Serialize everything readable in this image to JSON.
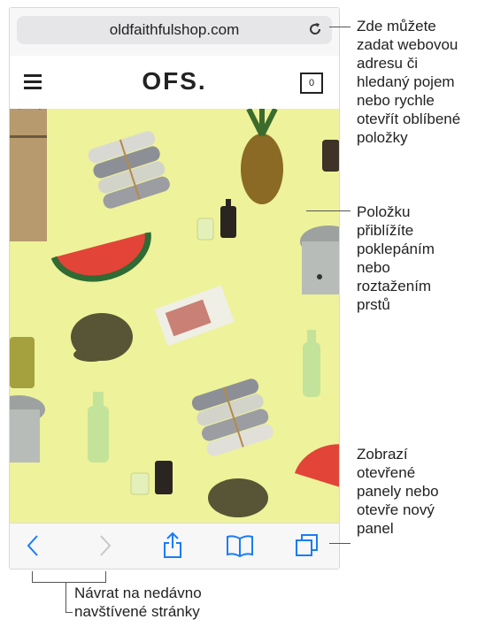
{
  "browser": {
    "url": "oldfaithfulshop.com"
  },
  "site": {
    "logo": "OFS.",
    "cart_count": "0"
  },
  "callouts": {
    "address": [
      "Zde můžete",
      "zadat webovou",
      "adresu či",
      "hledaný pojem",
      "nebo rychle",
      "otevřít oblíbené",
      "položky"
    ],
    "zoom": [
      "Položku",
      "přiblížíte",
      "poklepáním",
      "nebo",
      "roztažením",
      "prstů"
    ],
    "tabs": [
      "Zobrazí",
      "otevřené",
      "panely nebo",
      "otevře nový",
      "panel"
    ],
    "back": [
      "Návrat na nedávno",
      "navštívené stránky"
    ]
  },
  "colors": {
    "accent": "#1a7cf5",
    "hero_background": "#eef29a"
  },
  "toolbar_icons": [
    "back-chevron-icon",
    "forward-chevron-icon",
    "share-icon",
    "bookmarks-book-icon",
    "tabs-icon"
  ]
}
